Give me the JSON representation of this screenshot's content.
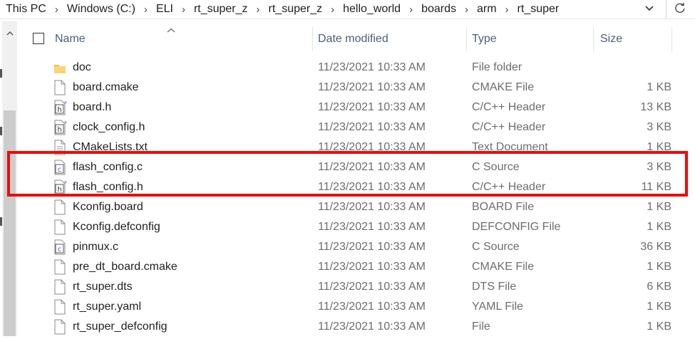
{
  "breadcrumb": [
    "This PC",
    "Windows (C:)",
    "ELI",
    "rt_super_z",
    "rt_super_z",
    "hello_world",
    "boards",
    "arm",
    "rt_super"
  ],
  "columns": {
    "name": "Name",
    "date": "Date modified",
    "type": "Type",
    "size": "Size"
  },
  "files": [
    {
      "name": "doc",
      "date": "11/23/2021 10:33 AM",
      "type": "File folder",
      "size": "",
      "icon": "folder-icon"
    },
    {
      "name": "board.cmake",
      "date": "11/23/2021 10:33 AM",
      "type": "CMAKE File",
      "size": "1 KB",
      "icon": "file-icon"
    },
    {
      "name": "board.h",
      "date": "11/23/2021 10:33 AM",
      "type": "C/C++ Header",
      "size": "13 KB",
      "icon": "header-file-icon"
    },
    {
      "name": "clock_config.h",
      "date": "11/23/2021 10:33 AM",
      "type": "C/C++ Header",
      "size": "3 KB",
      "icon": "header-file-icon"
    },
    {
      "name": "CMakeLists.txt",
      "date": "11/23/2021 10:33 AM",
      "type": "Text Document",
      "size": "1 KB",
      "icon": "text-file-icon"
    },
    {
      "name": "flash_config.c",
      "date": "11/23/2021 10:33 AM",
      "type": "C Source",
      "size": "3 KB",
      "icon": "c-source-file-icon"
    },
    {
      "name": "flash_config.h",
      "date": "11/23/2021 10:33 AM",
      "type": "C/C++ Header",
      "size": "11 KB",
      "icon": "header-file-icon"
    },
    {
      "name": "Kconfig.board",
      "date": "11/23/2021 10:33 AM",
      "type": "BOARD File",
      "size": "1 KB",
      "icon": "file-icon"
    },
    {
      "name": "Kconfig.defconfig",
      "date": "11/23/2021 10:33 AM",
      "type": "DEFCONFIG File",
      "size": "1 KB",
      "icon": "file-icon"
    },
    {
      "name": "pinmux.c",
      "date": "11/23/2021 10:33 AM",
      "type": "C Source",
      "size": "36 KB",
      "icon": "c-source-file-icon"
    },
    {
      "name": "pre_dt_board.cmake",
      "date": "11/23/2021 10:33 AM",
      "type": "CMAKE File",
      "size": "1 KB",
      "icon": "file-icon"
    },
    {
      "name": "rt_super.dts",
      "date": "11/23/2021 10:33 AM",
      "type": "DTS File",
      "size": "6 KB",
      "icon": "file-icon"
    },
    {
      "name": "rt_super.yaml",
      "date": "11/23/2021 10:33 AM",
      "type": "YAML File",
      "size": "1 KB",
      "icon": "file-icon"
    },
    {
      "name": "rt_super_defconfig",
      "date": "11/23/2021 10:33 AM",
      "type": "File",
      "size": "1 KB",
      "icon": "file-icon"
    }
  ],
  "colors": {
    "highlight": "#ee0a0a",
    "folder": "#f4c04e",
    "header_text": "#4c607a",
    "header_icon_accent": "#8a3fc4"
  }
}
